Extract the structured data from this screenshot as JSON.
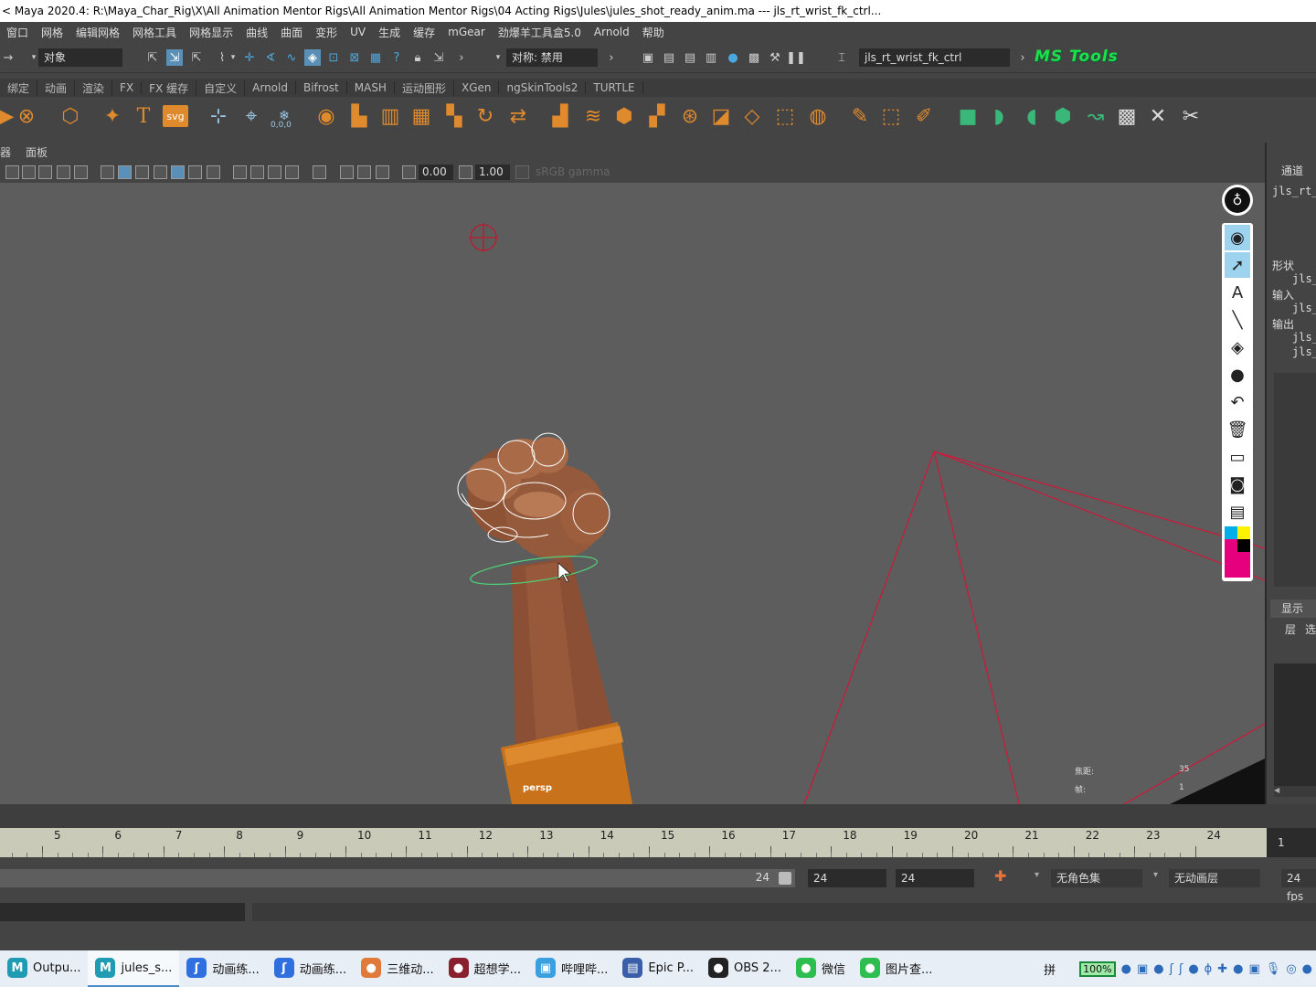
{
  "window": {
    "title": "< Maya 2020.4: R:\\Maya_Char_Rig\\X\\All Animation Mentor Rigs\\All Animation Mentor Rigs\\04 Acting Rigs\\Jules\\jules_shot_ready_anim.ma   ---   jls_rt_wrist_fk_ctrl..."
  },
  "menubar": {
    "items": [
      "窗口",
      "网格",
      "编辑网格",
      "网格工具",
      "网格显示",
      "曲线",
      "曲面",
      "变形",
      "UV",
      "生成",
      "缓存",
      "mGear",
      "劲爆羊工具盒5.0",
      "Arnold",
      "帮助"
    ]
  },
  "statusline": {
    "select_mode": "对象",
    "symmetry": "对称: 禁用",
    "name_field": "jls_rt_wrist_fk_ctrl",
    "ms_tools": "MS Tools"
  },
  "shelf_tabs": [
    "绑定",
    "动画",
    "渲染",
    "FX",
    "FX 缓存",
    "自定义",
    "Arnold",
    "Bifrost",
    "MASH",
    "运动图形",
    "XGen",
    "ngSkinTools2",
    "TURTLE"
  ],
  "shelf_icons": {
    "text_icon": "T",
    "svg_icon": "svg",
    "coord_label": "0,0,0"
  },
  "panel_menu": {
    "items": [
      "器",
      "面板"
    ]
  },
  "view_toolbar": {
    "exposure": "0.00",
    "gamma": "1.00",
    "color_space": "sRGB gamma"
  },
  "viewport": {
    "camera": "persp",
    "hud": [
      {
        "label": "焦距:",
        "value": "35"
      },
      {
        "label": "帧:",
        "value": "1"
      }
    ]
  },
  "channel_box": {
    "tab": "通道",
    "object": "jls_rt_",
    "sections": [
      "形状",
      "输入",
      "输出"
    ],
    "sub_items": [
      "jls_",
      "jls_",
      "jls_",
      "jls_"
    ],
    "display_tab": "显示",
    "layer_tabs": [
      "层",
      "选"
    ]
  },
  "timeline": {
    "frames": [
      "5",
      "6",
      "7",
      "8",
      "9",
      "10",
      "11",
      "12",
      "13",
      "14",
      "15",
      "16",
      "17",
      "18",
      "19",
      "20",
      "21",
      "22",
      "23",
      "24"
    ],
    "current_frame": "1"
  },
  "range": {
    "end_field": "24",
    "playback_end": "24",
    "anim_end": "24",
    "char_set": "无角色集",
    "anim_layer": "无动画层",
    "fps": "24 fps"
  },
  "taskbar": {
    "items": [
      {
        "label": "Outpu...",
        "color": "#1f9bb3",
        "glyph": "M"
      },
      {
        "label": "jules_s...",
        "color": "#1f9bb3",
        "glyph": "M"
      },
      {
        "label": "动画练...",
        "color": "#2f6fe0",
        "glyph": "ʃ"
      },
      {
        "label": "动画练...",
        "color": "#2f6fe0",
        "glyph": "ʃ"
      },
      {
        "label": "三维动...",
        "color": "#e07a3a",
        "glyph": "●"
      },
      {
        "label": "超想学...",
        "color": "#8a1f2e",
        "glyph": "●"
      },
      {
        "label": "哔哩哔...",
        "color": "#3aa0e0",
        "glyph": "▣"
      },
      {
        "label": "Epic P...",
        "color": "#3a5fa8",
        "glyph": "▤"
      },
      {
        "label": "OBS 2...",
        "color": "#222222",
        "glyph": "●"
      },
      {
        "label": "微信",
        "color": "#2ebd4f",
        "glyph": "●"
      },
      {
        "label": "图片查...",
        "color": "#2ebd4f",
        "glyph": "●"
      }
    ],
    "tray": {
      "ime": "拼",
      "battery": "100%"
    }
  },
  "colors": {
    "accent": "#5a8fb8",
    "ms_tools": "#1ee04a",
    "camera_frustum": "#d0183a",
    "wrist_ctrl": "#4fd17a"
  }
}
